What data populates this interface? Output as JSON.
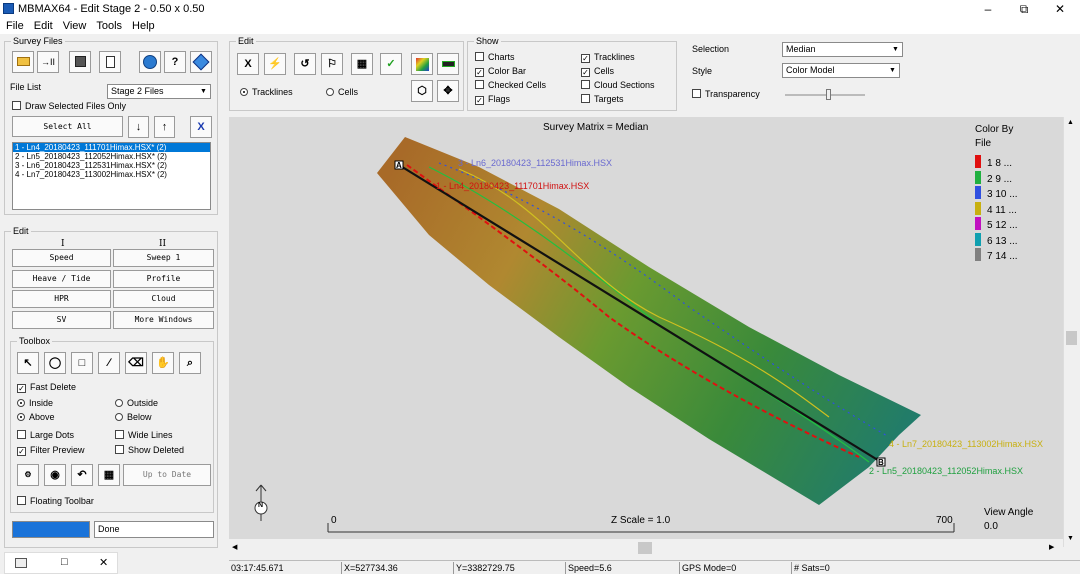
{
  "window": {
    "title": "MBMAX64 - Edit Stage 2 - 0.50 x 0.50"
  },
  "menu": [
    "File",
    "Edit",
    "View",
    "Tools",
    "Help"
  ],
  "survey_files": {
    "group_label": "Survey Files",
    "file_list_label": "File List",
    "file_list_value": "Stage 2 Files",
    "draw_selected_label": "Draw Selected Files Only",
    "select_all_label": "Select All",
    "files": [
      "1 - Ln4_20180423_111701Himax.HSX* (2)",
      "2 - Ln5_20180423_112052Himax.HSX* (2)",
      "3 - Ln6_20180423_112531Himax.HSX* (2)",
      "4 - Ln7_20180423_113002Himax.HSX* (2)"
    ]
  },
  "edit_left": {
    "group_label": "Edit",
    "col1": "I",
    "col2": "II",
    "buttons": [
      "Speed",
      "Sweep 1",
      "Heave / Tide",
      "Profile",
      "HPR",
      "Cloud",
      "SV",
      "More Windows"
    ]
  },
  "toolbox": {
    "group_label": "Toolbox",
    "fast_delete": "Fast Delete",
    "inside": "Inside",
    "outside": "Outside",
    "above": "Above",
    "below": "Below",
    "large_dots": "Large Dots",
    "wide_lines": "Wide Lines",
    "filter_preview": "Filter Preview",
    "show_deleted": "Show Deleted",
    "up_to_date": "Up to Date",
    "floating_toolbar": "Floating Toolbar",
    "progress": 1.0,
    "status": "Done"
  },
  "edit_top": {
    "group_label": "Edit",
    "tracklines": "Tracklines",
    "cells": "Cells"
  },
  "show": {
    "group_label": "Show",
    "items": [
      {
        "label": "Charts",
        "checked": false
      },
      {
        "label": "Tracklines",
        "checked": true
      },
      {
        "label": "Color Bar",
        "checked": true
      },
      {
        "label": "Cells",
        "checked": true
      },
      {
        "label": "Checked Cells",
        "checked": false
      },
      {
        "label": "Cloud Sections",
        "checked": false
      },
      {
        "label": "Flags",
        "checked": true
      },
      {
        "label": "Targets",
        "checked": false
      }
    ]
  },
  "selection": {
    "label": "Selection",
    "value": "Median"
  },
  "style": {
    "label": "Style",
    "value": "Color Model"
  },
  "transparency": {
    "label": "Transparency",
    "checked": false,
    "level": 0.55
  },
  "viewport": {
    "title": "Survey Matrix = Median",
    "legend_title_1": "Color By",
    "legend_title_2": "File",
    "legend": [
      {
        "text": "1  8  ...",
        "color": "#e01010"
      },
      {
        "text": "2  9  ...",
        "color": "#20b040"
      },
      {
        "text": "3  10  ...",
        "color": "#3050e0"
      },
      {
        "text": "4  11  ...",
        "color": "#c8b010"
      },
      {
        "text": "5  12  ...",
        "color": "#c010c0"
      },
      {
        "text": "6  13  ...",
        "color": "#10a0b0"
      },
      {
        "text": "7  14  ...",
        "color": "#808080"
      }
    ],
    "line_labels": {
      "l3": "3 - Ln6_20180423_112531Himax.HSX",
      "l1": "1 - Ln4_20180423_111701Himax.HSX",
      "l4": "4 - Ln7_20180423_113002Himax.HSX",
      "l2": "2 - Ln5_20180423_112052Himax.HSX"
    },
    "point_a": "A",
    "point_b": "B",
    "north": "N",
    "scale_label": "Z Scale = 1.0",
    "scale_min": "0",
    "scale_max": "700",
    "view_angle_label": "View Angle",
    "view_angle_value": "0.0"
  },
  "status": {
    "time": "03:17:45.671",
    "x": "X=527734.36",
    "y": "Y=3382729.75",
    "speed": "Speed=5.6",
    "gps": "GPS Mode=0",
    "sats": "# Sats=0"
  },
  "colors": {
    "accent": "#0078d7",
    "progress": "#1a73d9"
  }
}
